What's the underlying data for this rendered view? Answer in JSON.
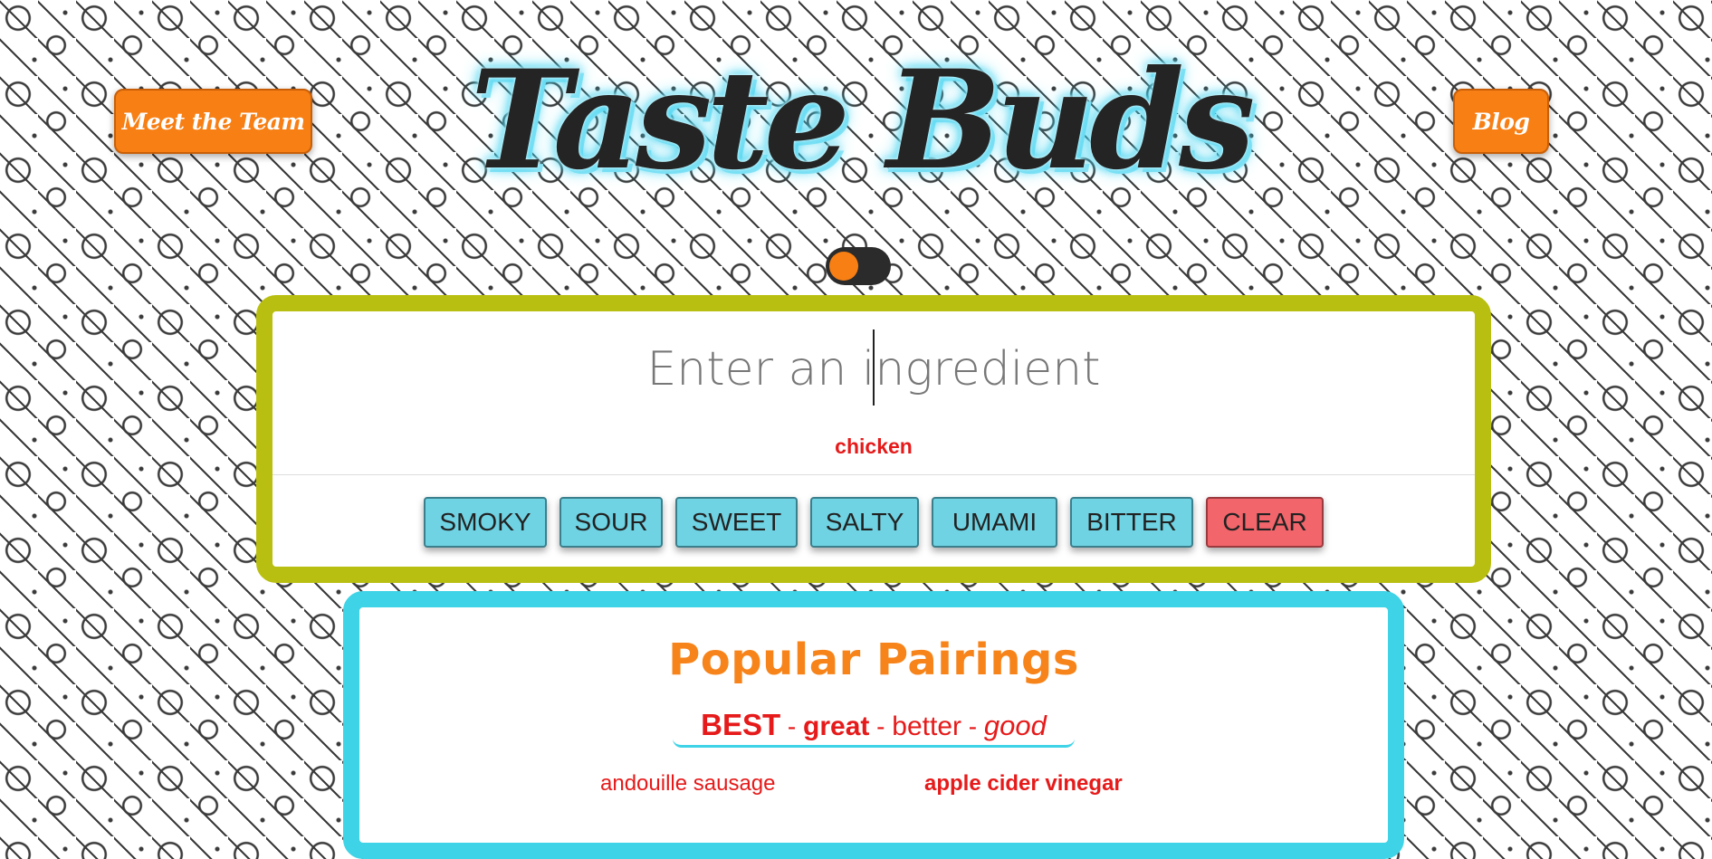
{
  "nav": {
    "team_label": "Meet the Team",
    "blog_label": "Blog"
  },
  "title": "Taste Buds",
  "search": {
    "placeholder": "Enter an ingredient",
    "value": ""
  },
  "selected_ingredient": "chicken",
  "flavors": [
    "SMOKY",
    "SOUR",
    "SWEET",
    "SALTY",
    "UMAMI",
    "BITTER"
  ],
  "clear_label": "CLEAR",
  "pairings": {
    "title": "Popular Pairings",
    "legend": {
      "best": "BEST",
      "great": "great",
      "better": "better",
      "good": "good",
      "sep": " - "
    },
    "items": [
      {
        "name": "andouille sausage",
        "rank": "better"
      },
      {
        "name": "apple cider vinegar",
        "rank": "great"
      }
    ]
  },
  "colors": {
    "accent_orange": "#f77f14",
    "search_border": "#b9bf10",
    "pairing_border": "#3ed3e6",
    "flavor_button": "#6fd3e3",
    "clear_button": "#f2656b",
    "ingredient_text": "#e61a1a"
  }
}
